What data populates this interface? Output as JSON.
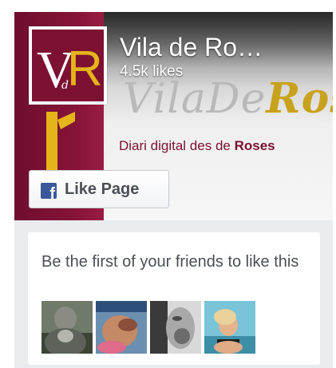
{
  "page": {
    "name": "Vila de Ro…",
    "likes": "4.5k likes",
    "logo_text": "VR"
  },
  "cover": {
    "brand_text_light": "VilaDe",
    "brand_text_accent": "Ros",
    "tagline_prefix": "Diari digital des de ",
    "tagline_bold": "Roses"
  },
  "like_button": {
    "label": "Like Page",
    "icon_glyph": "f",
    "icon": "facebook-icon"
  },
  "friends": {
    "message": "Be the first of your friends to like this",
    "avatars": [
      "avatar-1",
      "avatar-2",
      "avatar-3",
      "avatar-4"
    ]
  },
  "colors": {
    "brand_maroon": "#7d1132",
    "brand_gold": "#e5b418",
    "facebook_blue": "#3b5998"
  }
}
